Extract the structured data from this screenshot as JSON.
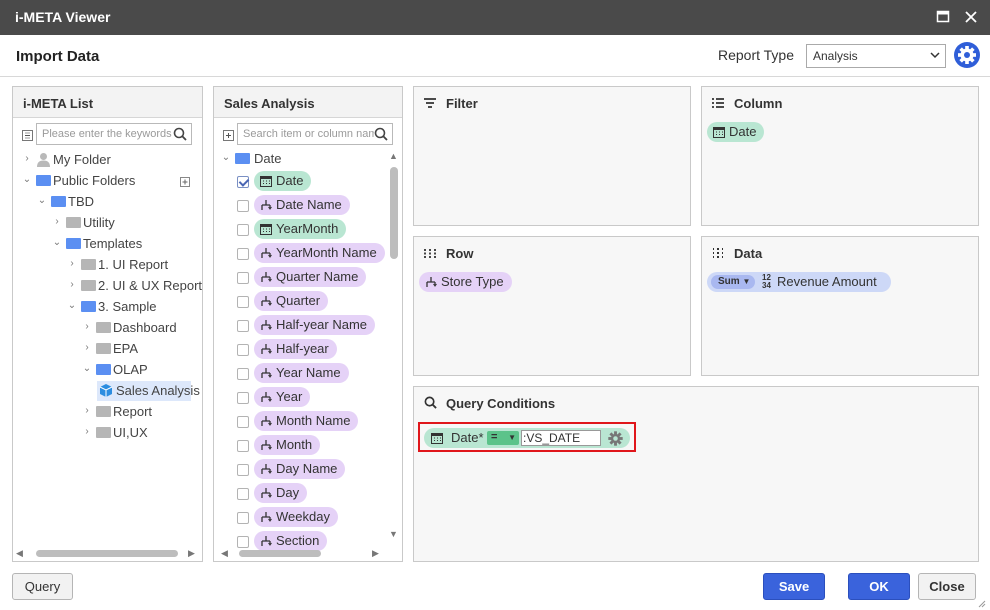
{
  "window": {
    "title": "i-META Viewer"
  },
  "header": {
    "title": "Import Data",
    "report_type_label": "Report Type",
    "report_type_value": "Analysis"
  },
  "meta_list": {
    "title": "i-META List",
    "search_placeholder": "Please enter the keywords",
    "tree": [
      {
        "label": "My Folder"
      },
      {
        "label": "Public Folders"
      },
      {
        "label": "TBD"
      },
      {
        "label": "Utility"
      },
      {
        "label": "Templates"
      },
      {
        "label": "1. UI Report"
      },
      {
        "label": "2. UI & UX Report"
      },
      {
        "label": "3. Sample"
      },
      {
        "label": "Dashboard"
      },
      {
        "label": "EPA"
      },
      {
        "label": "OLAP"
      },
      {
        "label": "Sales Analysis"
      },
      {
        "label": "Report"
      },
      {
        "label": "UI,UX"
      }
    ]
  },
  "sales_analysis": {
    "title": "Sales Analysis",
    "search_placeholder": "Search item or column name",
    "group_label": "Date",
    "items": [
      {
        "label": "Date",
        "checked": true
      },
      {
        "label": "Date Name",
        "checked": false
      },
      {
        "label": "YearMonth",
        "checked": false
      },
      {
        "label": "YearMonth Name",
        "checked": false
      },
      {
        "label": "Quarter Name",
        "checked": false
      },
      {
        "label": "Quarter",
        "checked": false
      },
      {
        "label": "Half-year Name",
        "checked": false
      },
      {
        "label": "Half-year",
        "checked": false
      },
      {
        "label": "Year Name",
        "checked": false
      },
      {
        "label": "Year",
        "checked": false
      },
      {
        "label": "Month Name",
        "checked": false
      },
      {
        "label": "Month",
        "checked": false
      },
      {
        "label": "Day Name",
        "checked": false
      },
      {
        "label": "Day",
        "checked": false
      },
      {
        "label": "Weekday",
        "checked": false
      },
      {
        "label": "Section",
        "checked": false
      }
    ]
  },
  "filter": {
    "title": "Filter"
  },
  "column": {
    "title": "Column",
    "items": [
      "Date"
    ]
  },
  "row": {
    "title": "Row",
    "items": [
      "Store Type"
    ]
  },
  "data_panel": {
    "title": "Data",
    "agg": "Sum",
    "num_icon_top": "12",
    "num_icon_bottom": "34",
    "item": "Revenue Amount"
  },
  "query_conditions": {
    "title": "Query Conditions",
    "field": "Date*",
    "operator": "=",
    "value": ":VS_DATE"
  },
  "footer": {
    "query": "Query",
    "save": "Save",
    "ok": "OK",
    "close": "Close"
  },
  "colors": {
    "accent": "#3a63dc",
    "green_chip": "#b9e6d2",
    "purple_chip": "#e5d2f7",
    "highlight_border": "#e0161b"
  }
}
